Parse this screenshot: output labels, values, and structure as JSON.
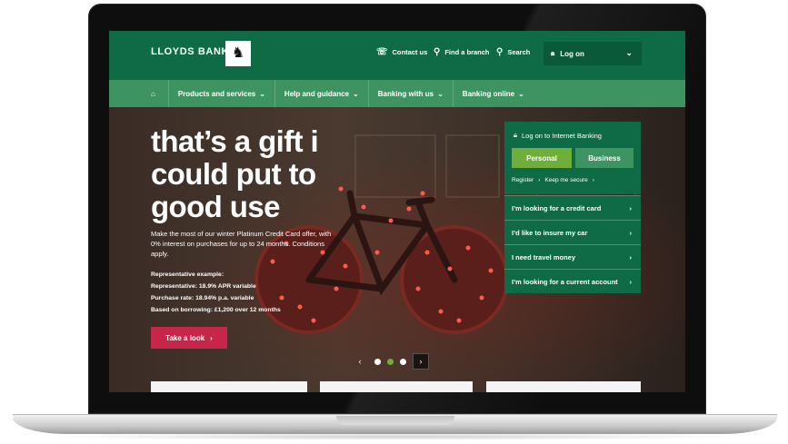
{
  "header": {
    "brand": "LLOYDS BANK",
    "contact": "Contact us",
    "find_branch": "Find a branch",
    "search": "Search",
    "logon": "Log on"
  },
  "nav": {
    "items": [
      {
        "label": "Products and services"
      },
      {
        "label": "Help and guidance"
      },
      {
        "label": "Banking with us"
      },
      {
        "label": "Banking online"
      }
    ]
  },
  "hero": {
    "title": "that’s a gift i could put to good use",
    "subtitle": "Make the most of our winter Platinum Credit Card offer, with 0% interest on purchases for up to 24 months. Conditions apply.",
    "rep_heading": "Representative example:",
    "rep_line1": "Representative: 18.9% APR variable",
    "rep_line2": "Purchase rate: 18.94% p.a. variable",
    "rep_line3": "Based on borrowing: £1,200 over 12 months",
    "cta": "Take a look"
  },
  "login": {
    "title": "Log on to Internet Banking",
    "personal": "Personal",
    "business": "Business",
    "register": "Register",
    "keep_secure": "Keep me secure"
  },
  "quick_links": [
    {
      "label": "I’m looking for a credit card"
    },
    {
      "label": "I’d like to insure my car"
    },
    {
      "label": "I need travel money"
    },
    {
      "label": "I’m looking for a current account"
    }
  ],
  "carousel": {
    "slides": 3,
    "active": 2
  },
  "colors": {
    "brand_green": "#0f6b46",
    "nav_green": "#3d9460",
    "accent_green": "#6fae3a",
    "cta_red": "#c7264a"
  }
}
